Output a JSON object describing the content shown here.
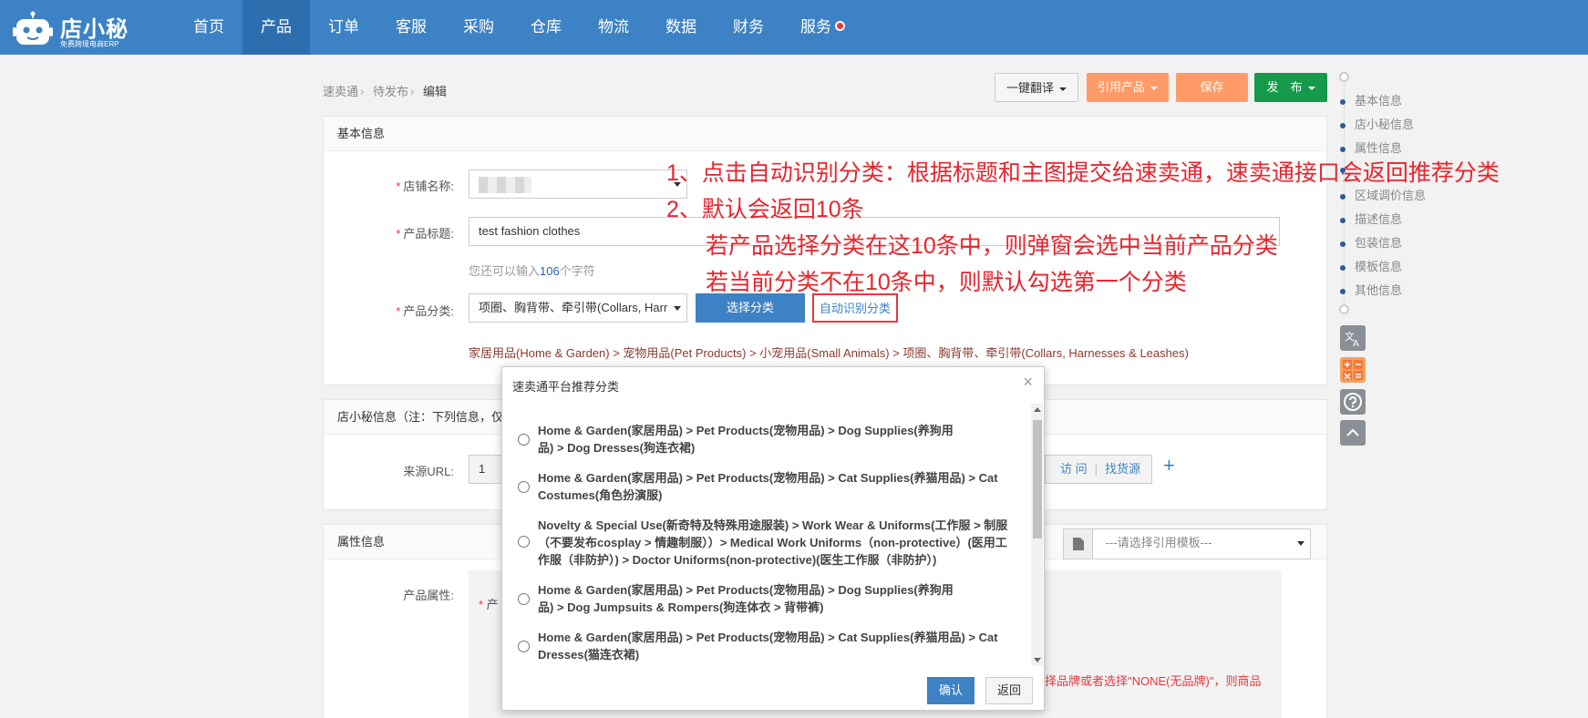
{
  "header": {
    "brand": "店小秘",
    "brand_sub": "免费跨境电商ERP",
    "nav": [
      "首页",
      "产品",
      "订单",
      "客服",
      "采购",
      "仓库",
      "物流",
      "数据",
      "财务",
      "服务"
    ]
  },
  "breadcrumb": [
    "速卖通",
    "待发布",
    "编辑"
  ],
  "actions": {
    "translate": "一键翻译",
    "cite": "引用产品",
    "save": "保存",
    "publish": "发　布"
  },
  "basic": {
    "title": "基本信息",
    "shop_label": "店铺名称:",
    "title_label": "产品标题:",
    "title_value": "test  fashion  clothes",
    "remain_prefix": "您还可以输入",
    "remain_count": "106",
    "remain_suffix": "个字符",
    "category_label": "产品分类:",
    "category_value": "项圈、胸背带、牵引带(Collars, Harr",
    "select_btn": "选择分类",
    "auto_btn": "自动识别分类",
    "category_path": "家居用品(Home & Garden) > 宠物用品(Pet Products) > 小宠用品(Small Animals) > 项圈、胸背带、牵引带(Collars, Harnesses & Leashes)"
  },
  "annotations": [
    "1、点击自动识别分类：根据标题和主图提交给速卖通，速卖通接口会返回推荐分类",
    "2、默认会返回10条",
    "若产品选择分类在这10条中，则弹窗会选中当前产品分类",
    "若当前分类不在10条中，则默认勾选第一个分类"
  ],
  "dxm_info": {
    "title": "店小秘信息（注：下列信息，仅",
    "source_label": "来源URL:",
    "source_value": "1",
    "visit": "访 问",
    "find": "找货源",
    "add": "+"
  },
  "attr": {
    "title": "属性信息",
    "template_placeholder": "---请选择引用模板---",
    "product_attr_label": "产品属性:",
    "attr_partial": "产",
    "brand_note": "择品牌或者选择\"NONE(无品牌)\"，则商品"
  },
  "rail": {
    "items": [
      "基本信息",
      "店小秘信息",
      "属性信息",
      "",
      "区域调价信息",
      "描述信息",
      "包装信息",
      "模板信息",
      "其他信息"
    ]
  },
  "modal": {
    "title": "速卖通平台推荐分类",
    "close": "×",
    "options": [
      "Home & Garden(家居用品) > Pet Products(宠物用品) > Dog Supplies(养狗用品) > Dog Dresses(狗连衣裙)",
      "Home & Garden(家居用品) > Pet Products(宠物用品) > Cat Supplies(养猫用品) > Cat Costumes(角色扮演服)",
      "Novelty & Special Use(新奇特及特殊用途服装) > Work Wear & Uniforms(工作服 > 制服（不要发布cosplay > 情趣制服））> Medical Work Uniforms（non-protective）(医用工作服（非防护）) > Doctor Uniforms(non-protective)(医生工作服（非防护）)",
      "Home & Garden(家居用品) > Pet Products(宠物用品) > Dog Supplies(养狗用品) > Dog Jumpsuits & Rompers(狗连体衣 > 背带裤)",
      "Home & Garden(家居用品) > Pet Products(宠物用品) > Cat Supplies(养猫用品) > Cat Dresses(猫连衣裙)"
    ],
    "ok": "确认",
    "back": "返回"
  }
}
